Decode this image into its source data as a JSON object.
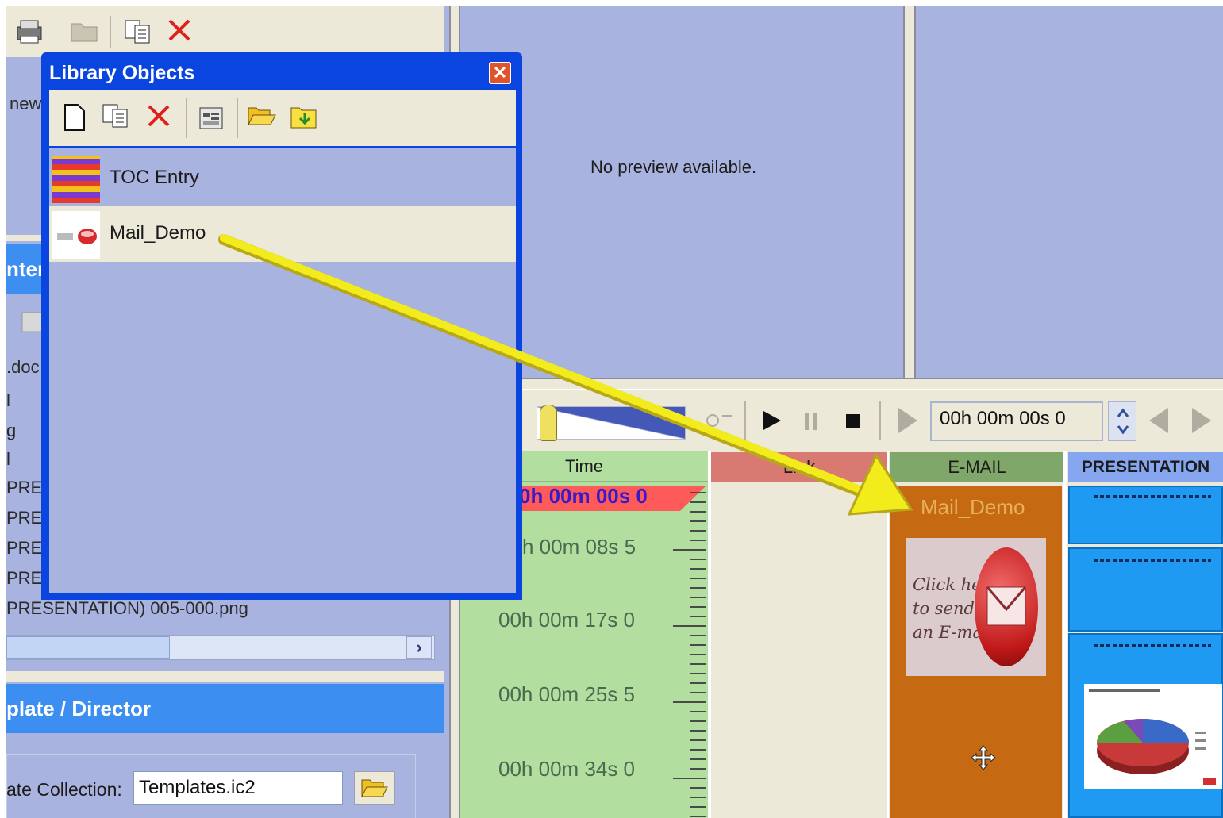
{
  "dialog": {
    "title": "Library Objects",
    "items": [
      {
        "label": "TOC Entry"
      },
      {
        "label": "Mail_Demo",
        "selected": true
      }
    ]
  },
  "left_panel": {
    "partial_label_new": "new",
    "content_header": "nter",
    "files": [
      ".doc",
      "l",
      "g",
      "l",
      "PRES",
      "PRES",
      "PRES",
      "PRES",
      "PRESENTATION) 005-000.png"
    ],
    "template_header": "plate / Director",
    "template_collection_label": "ate Collection:",
    "template_collection_value": "Templates.ic2"
  },
  "preview": {
    "message": "No preview available."
  },
  "playback": {
    "time": "00h 00m 00s 0"
  },
  "timeline": {
    "columns": [
      "Time",
      "Link",
      "E-MAIL",
      "PRESENTATION"
    ],
    "current_time": "0h 00m 00s 0",
    "time_labels": [
      "h 00m 08s 5",
      "00h 00m 17s 0",
      "00h 00m 25s 5",
      "00h 00m 34s 0"
    ],
    "email_item": {
      "title": "Mail_Demo",
      "thumb_text": "Click here\nto send us\nan E-mail"
    }
  },
  "colors": {
    "panel_blue": "#a9b3df",
    "header_blue": "#3c8ef0",
    "dialog_border": "#0b45e0",
    "email_block": "#c56a12",
    "time_column": "#b2dea0",
    "arrow": "#f2ec1c"
  },
  "icons": [
    "print-icon",
    "folder-icon",
    "copy-icon",
    "delete-icon",
    "new-document-icon",
    "properties-icon",
    "open-folder-icon",
    "import-icon",
    "play-icon",
    "pause-icon",
    "stop-icon",
    "step-forward-icon",
    "previous-icon",
    "next-icon",
    "move-cursor-icon",
    "close-icon",
    "scroll-right-icon"
  ]
}
